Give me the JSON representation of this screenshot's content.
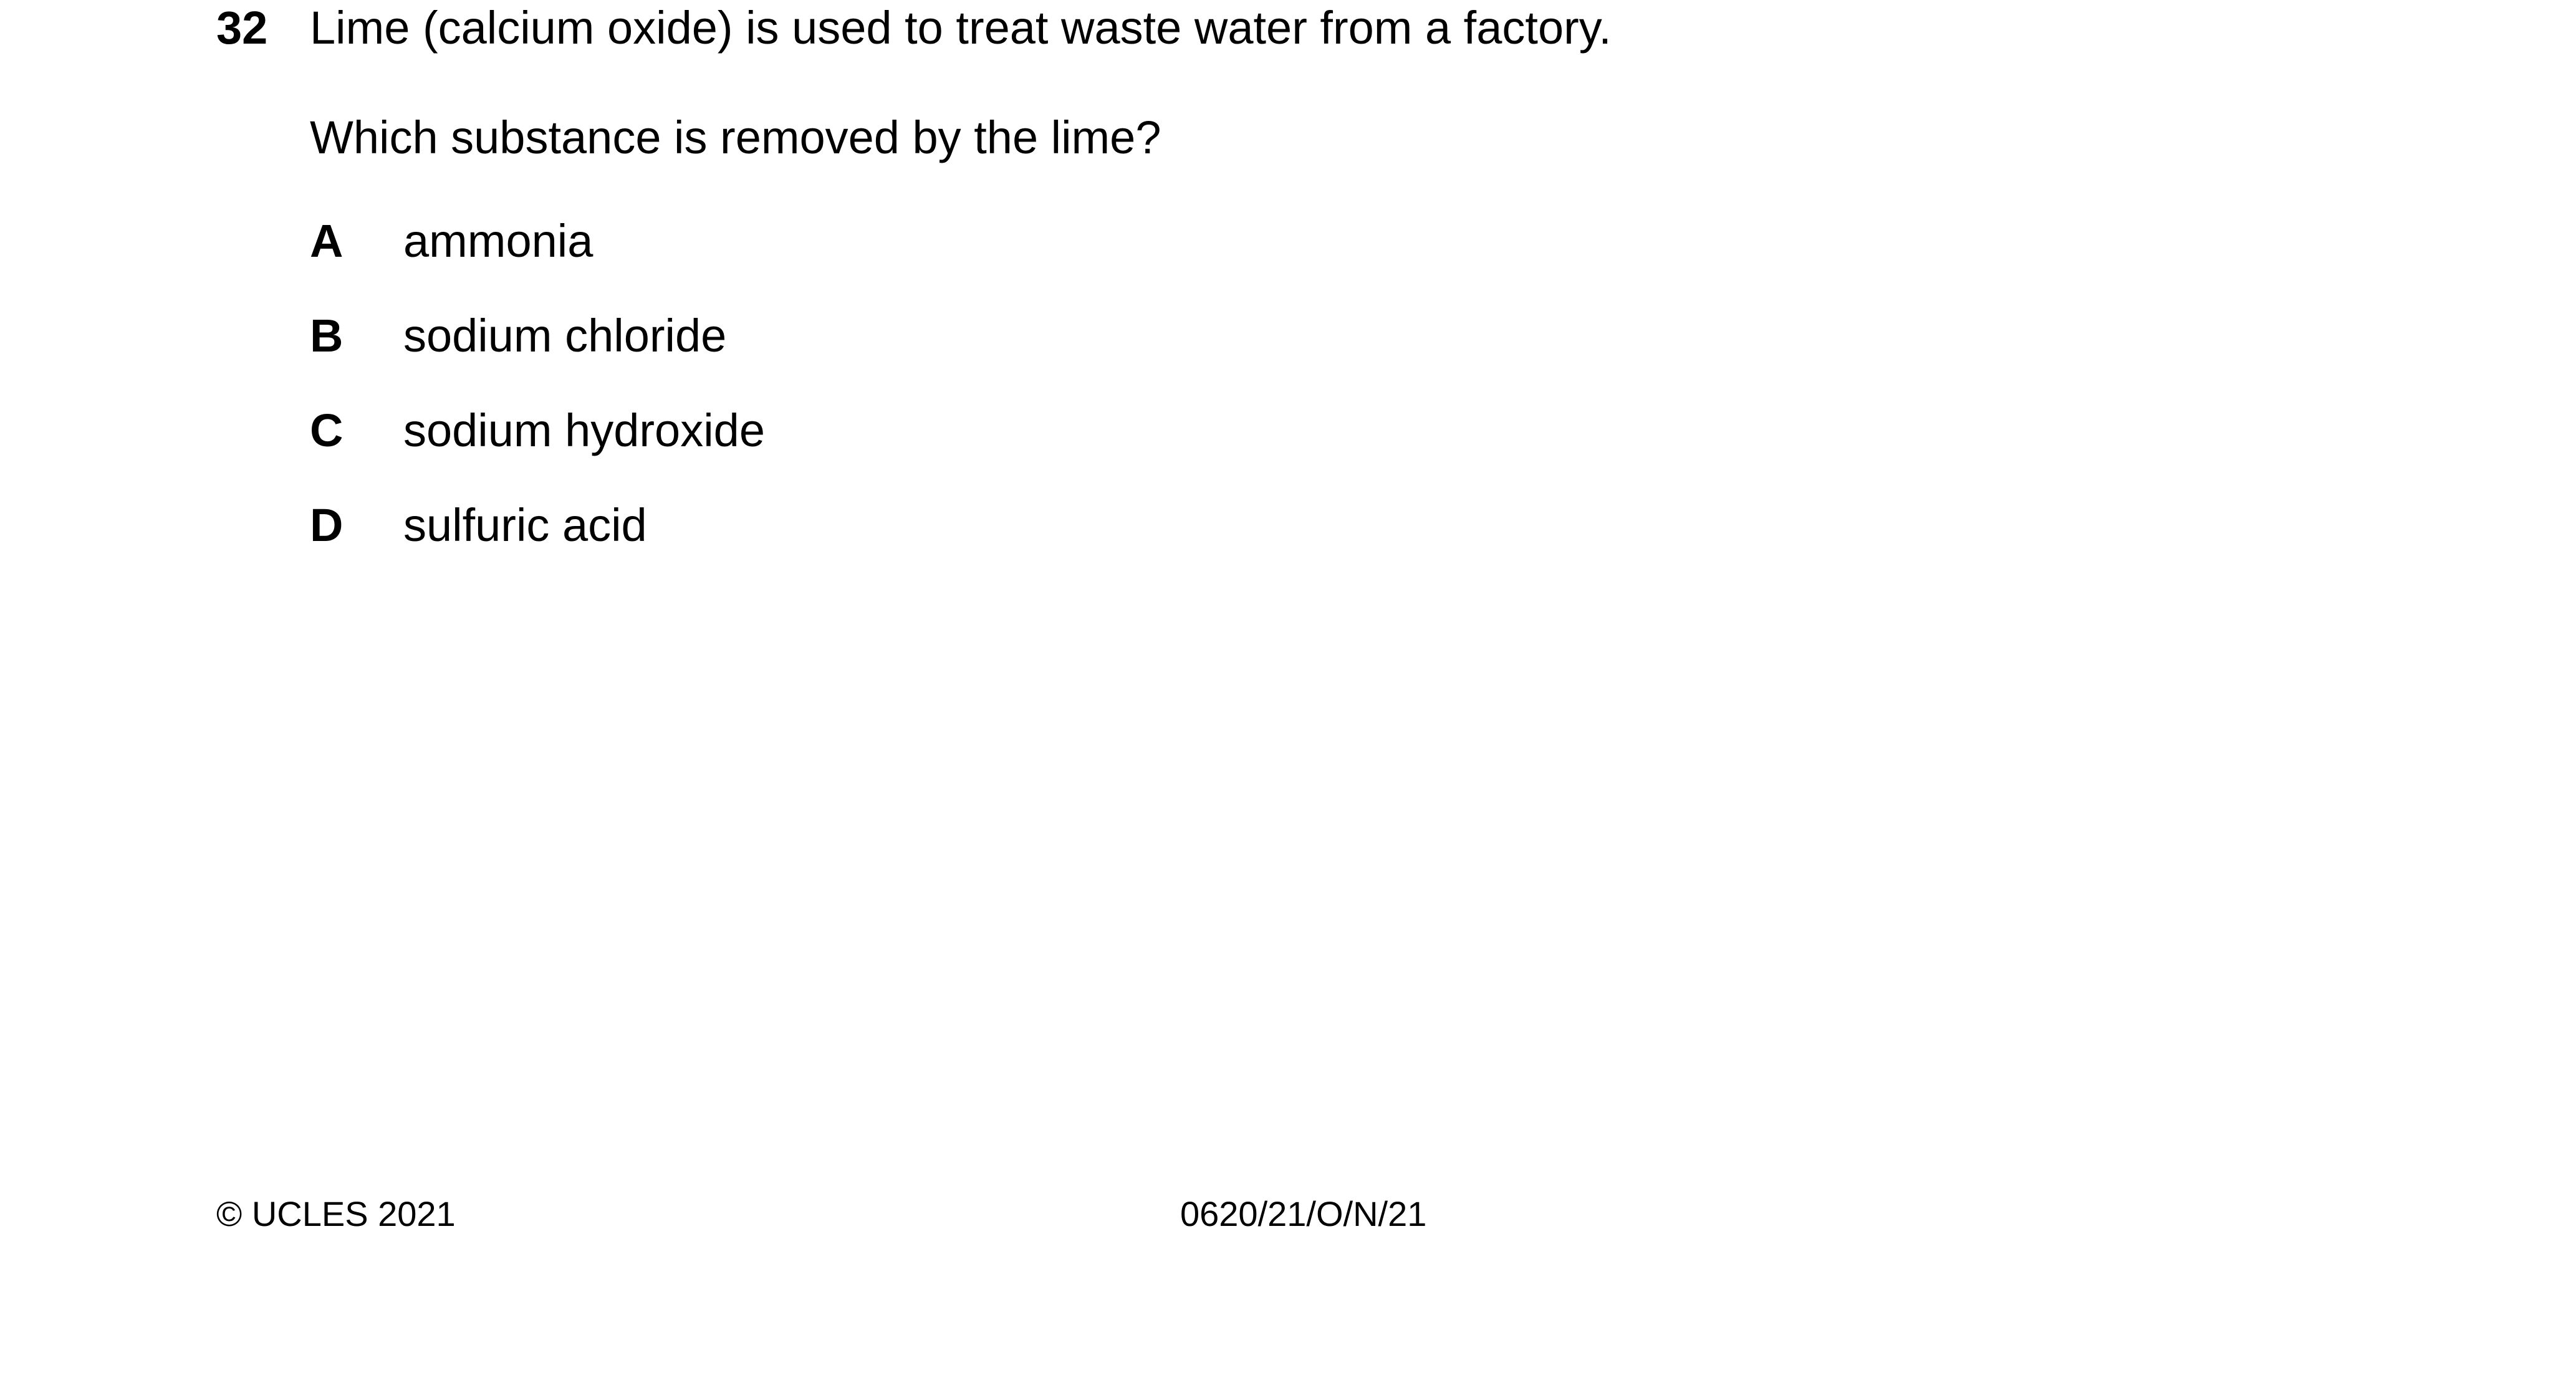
{
  "question": {
    "number": "32",
    "stem": "Lime (calcium oxide) is used to treat waste water from a factory.",
    "prompt": "Which substance is removed by the lime?",
    "options": [
      {
        "letter": "A",
        "text": "ammonia"
      },
      {
        "letter": "B",
        "text": "sodium chloride"
      },
      {
        "letter": "C",
        "text": "sodium hydroxide"
      },
      {
        "letter": "D",
        "text": "sulfuric acid"
      }
    ]
  },
  "footer": {
    "copyright": "© UCLES 2021",
    "paper_code": "0620/21/O/N/21"
  }
}
